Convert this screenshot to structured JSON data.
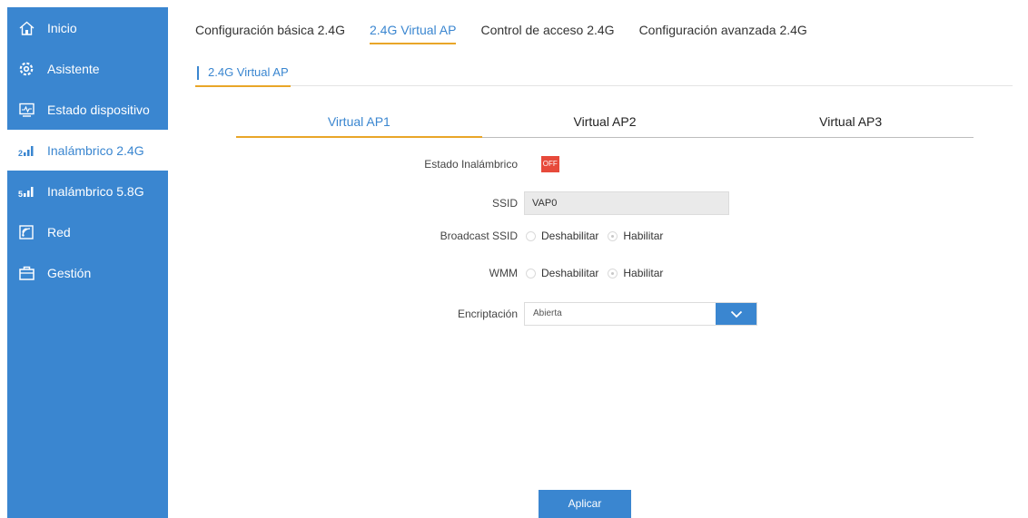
{
  "sidebar": {
    "items": [
      {
        "label": "Inicio",
        "icon": "home-icon"
      },
      {
        "label": "Asistente",
        "icon": "gear-icon"
      },
      {
        "label": "Estado dispositivo",
        "icon": "monitor-icon"
      },
      {
        "label": "Inalámbrico 2.4G",
        "icon": "signal-2g-icon"
      },
      {
        "label": "Inalámbrico 5.8G",
        "icon": "signal-5g-icon"
      },
      {
        "label": "Red",
        "icon": "network-icon"
      },
      {
        "label": "Gestión",
        "icon": "briefcase-icon"
      }
    ],
    "active_index": 3,
    "colors": {
      "background": "#3a86d0",
      "active_text": "#3a86d0"
    }
  },
  "top_tabs": [
    {
      "label": "Configuración básica 2.4G"
    },
    {
      "label": "2.4G Virtual AP"
    },
    {
      "label": "Control de acceso 2.4G"
    },
    {
      "label": "Configuración avanzada 2.4G"
    }
  ],
  "top_tabs_active_index": 1,
  "section": {
    "title": "2.4G Virtual AP"
  },
  "sub_tabs": [
    {
      "label": "Virtual AP1"
    },
    {
      "label": "Virtual AP2"
    },
    {
      "label": "Virtual AP3"
    }
  ],
  "sub_tabs_active_index": 0,
  "form": {
    "wireless_status": {
      "label": "Estado Inalámbrico",
      "state": "OFF"
    },
    "ssid": {
      "label": "SSID",
      "value": "VAP0"
    },
    "broadcast_ssid": {
      "label": "Broadcast SSID",
      "option_disable": "Deshabilitar",
      "option_enable": "Habilitar",
      "selected": "Habilitar"
    },
    "wmm": {
      "label": "WMM",
      "option_disable": "Deshabilitar",
      "option_enable": "Habilitar",
      "selected": "Habilitar"
    },
    "encryption": {
      "label": "Encriptación",
      "value": "Abierta"
    }
  },
  "apply_label": "Aplicar",
  "colors": {
    "accent": "#3a86d0",
    "tab_underline": "#e9a628",
    "off_badge": "#e74a3b"
  }
}
